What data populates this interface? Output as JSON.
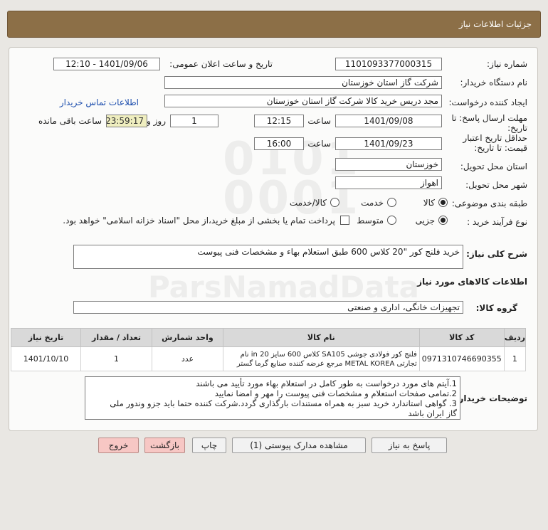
{
  "header": {
    "title": "جزئیات اطلاعات نیاز"
  },
  "form": {
    "need_number": {
      "label": "شماره نیاز:",
      "value": "1101093377000315"
    },
    "announce_datetime": {
      "label": "تاریخ و ساعت اعلان عمومی:",
      "value": "1401/09/06 - 12:10"
    },
    "buyer_org": {
      "label": "نام دستگاه خریدار:",
      "value": "شرکت گاز استان خوزستان"
    },
    "requester": {
      "label": "ایجاد کننده درخواست:",
      "value": "مجد دریس خرید کالا شرکت گاز استان خوزستان"
    },
    "contact_link": "اطلاعات تماس خریدار",
    "reply_deadline": {
      "label_line1": "مهلت ارسال پاسخ: تا",
      "label_line2": "تاریخ:",
      "date": "1401/09/08",
      "time_label": "ساعت",
      "time": "12:15",
      "days": "1",
      "days_label": "روز و",
      "remaining": "23:59:17",
      "remaining_label": "ساعت باقی مانده"
    },
    "price_validity": {
      "label_line1": "حداقل تاریخ اعتبار",
      "label_line2": "قیمت: تا تاریخ:",
      "date": "1401/09/23",
      "time_label": "ساعت",
      "time": "16:00"
    },
    "delivery_province": {
      "label": "استان محل تحویل:",
      "value": "خوزستان"
    },
    "delivery_city": {
      "label": "شهر محل تحویل:",
      "value": "اهواز"
    },
    "category": {
      "label": "طبقه بندی موضوعی:",
      "options": [
        "کالا",
        "خدمت",
        "کالا/خدمت"
      ],
      "selected": "کالا"
    },
    "purchase_type": {
      "label": "نوع فرآیند خرید :",
      "options": [
        "جزیی",
        "متوسط"
      ],
      "selected": "جزیی",
      "treasury_note": "پرداخت تمام یا بخشی از مبلغ خرید،از محل \"اسناد خزانه اسلامی\" خواهد بود."
    }
  },
  "description": {
    "label": "شرح کلی نیاز:",
    "value": "خرید فلنج کور \"20 کلاس 600 طبق استعلام بهاء و مشخصات فنی پیوست"
  },
  "goods_section_title": "اطلاعات کالاهای مورد نیاز",
  "goods_group": {
    "label": "گروه کالا:",
    "value": "تجهیزات خانگی، اداری و صنعتی"
  },
  "table": {
    "headers": [
      "ردیف",
      "کد کالا",
      "نام کالا",
      "واحد شمارش",
      "تعداد / مقدار",
      "تاریخ نیاز"
    ],
    "rows": [
      {
        "row": "1",
        "code": "0971310746690355",
        "name_line1": "فلنج کور فولادی جوشی SA105 کلاس 600 سایز 20 in نام",
        "name_line2": "تجارتی METAL KOREA مرجع عرضه کننده صنایع گرما گستر",
        "unit": "عدد",
        "qty": "1",
        "date": "1401/10/10"
      }
    ]
  },
  "buyer_notes": {
    "label": "توضیحات خریدار:",
    "lines": [
      "1.آیتم های مورد درخواست به طور کامل در استعلام بهاء مورد تأیید می باشند",
      "2.تمامی صفحات استعلام و مشخصات فنی پیوست را مهر و امضا نمایید",
      "3. گواهی استاندارد خرید سبز به همراه مستندات بارگذاری گردد.شرکت کننده حتما باید جزو وندور ملی",
      "گاز ایران باشد"
    ]
  },
  "buttons": {
    "reply": "پاسخ به نیاز",
    "attachments": "مشاهده مدارک پیوستی (1)",
    "print": "چاپ",
    "back": "بازگشت",
    "exit": "خروج"
  }
}
